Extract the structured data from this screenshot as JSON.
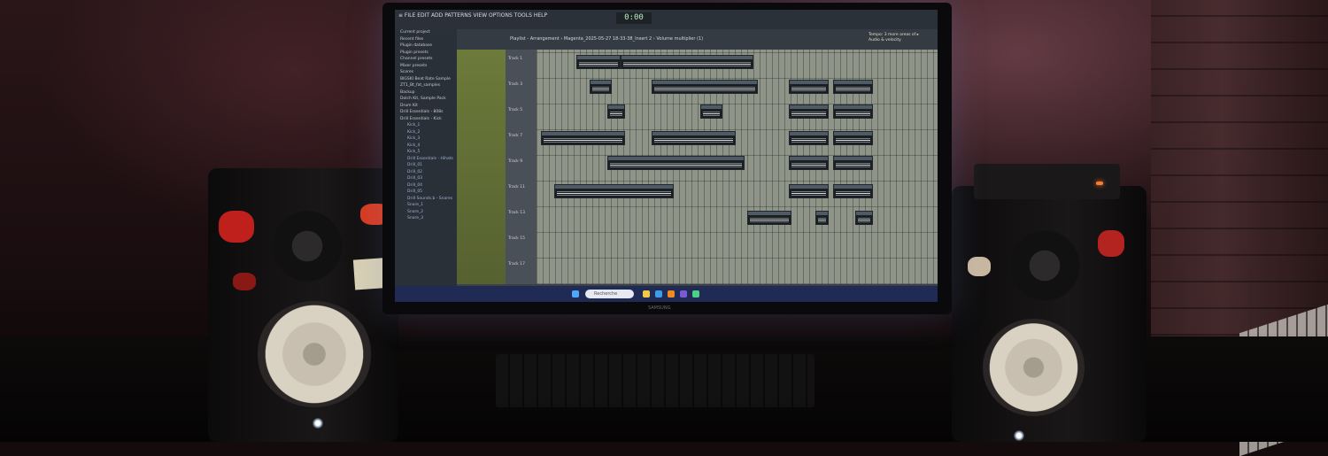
{
  "scene": {
    "description_free": true,
    "accent_colors": {
      "screen_bg": "#3a4046",
      "channel_green": "#6c7a3a",
      "taskbar_blue": "#1f2a55",
      "interface_led": "#ff7a2e"
    }
  },
  "daw": {
    "time": "0:00",
    "playlist_title": "Playlist - Arrangement › Magenta_2025-05-27 18-33-38_Insert 2 › Volume  multiplier (1)",
    "hint": "Tempo: 3 more areas of\n ▸ Audio & velocity",
    "browser_items": [
      "Current project",
      "Recent files",
      "Plugin database",
      "Plugin presets",
      "Channel presets",
      "Mixer presets",
      "Scores",
      "BIGSKI Beat Rate Sample",
      "ZT1_Bt_fat_samples",
      "Backup",
      "Dolch Kit, Sample Pack",
      "Drum Kit",
      "Drill Essentials - 808s",
      "Drill Essentials - Kick"
    ],
    "browser_sub_items": [
      "Kick_1",
      "Kick_2",
      "Kick_3",
      "Kick_4",
      "Kick_5",
      "Drill Essentials - Hihats",
      "Drill_01",
      "Drill_02",
      "Drill_03",
      "Drill_04",
      "Drill_05",
      "Drill Sounds.b - Snares",
      "Snare_1",
      "Snare_2",
      "Snare_3"
    ],
    "tracks": [
      "Track 1",
      "Track 3",
      "Track 5",
      "Track 7",
      "Track 9",
      "Track 11",
      "Track 13",
      "Track 15",
      "Track 17"
    ]
  },
  "taskbar": {
    "search_placeholder": "Recherche"
  },
  "monitor_brand": "SAMSUNG"
}
